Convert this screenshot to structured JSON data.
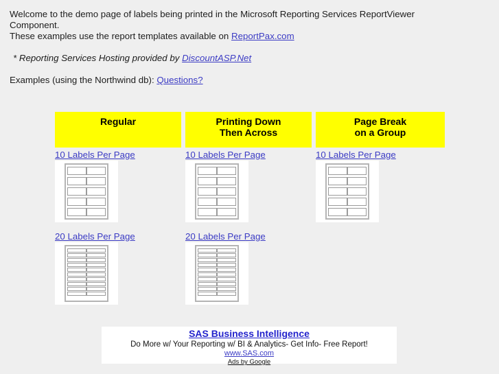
{
  "intro": {
    "line1": "Welcome to the demo page of labels being printed in the Microsoft Reporting Services ReportViewer Component.",
    "line2_prefix": "These examples use the report templates available on ",
    "line2_link": "ReportPax.com",
    "hosting_prefix": "* Reporting Services Hosting provided by ",
    "hosting_link": "DiscountASP.Net",
    "examples_prefix": "Examples (using the Northwind db): ",
    "examples_link": "Questions?"
  },
  "headers": [
    {
      "line1": "Regular",
      "line2": ""
    },
    {
      "line1": "Printing Down",
      "line2": "Then Across"
    },
    {
      "line1": "Page Break",
      "line2": "on a Group"
    }
  ],
  "columns": [
    {
      "link_10": "10 Labels Per Page",
      "link_20": "20 Labels Per Page"
    },
    {
      "link_10": "10 Labels Per Page",
      "link_20": "20 Labels Per Page"
    },
    {
      "link_10": "10 Labels Per Page",
      "link_20": ""
    }
  ],
  "thumbnails": {
    "ten_per_page": {
      "columns": 2,
      "rows": 5
    },
    "twenty_per_page": {
      "columns": 2,
      "rows": 10
    }
  },
  "ad": {
    "title": "SAS Business Intelligence",
    "description": "Do More w/ Your Reporting w/ BI & Analytics- Get Info- Free Report!",
    "url": "www.SAS.com",
    "credit": "Ads by Google"
  },
  "colors": {
    "page_background": "#efefef",
    "header_cell": "#ffff00",
    "link": "#3b3bc4",
    "ad_title": "#2222cc",
    "sheet_background": "#ffffff",
    "label_border": "#9a9a9a"
  }
}
